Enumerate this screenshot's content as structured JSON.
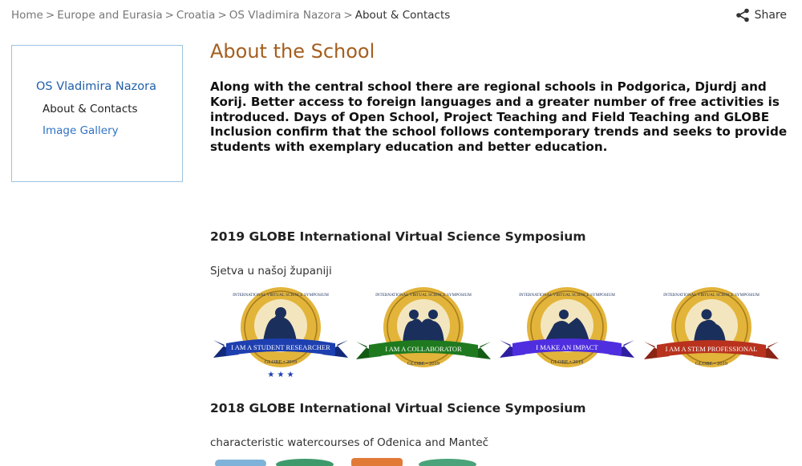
{
  "breadcrumb": {
    "items": [
      "Home",
      "Europe and Eurasia",
      "Croatia",
      "OS Vladimira Nazora"
    ],
    "separator": ">",
    "current": "About & Contacts"
  },
  "share": {
    "label": "Share",
    "icon": "share-icon"
  },
  "sidebar": {
    "school_name": "OS Vladimira Nazora",
    "items": [
      {
        "label": "About & Contacts",
        "active": true
      },
      {
        "label": "Image Gallery",
        "active": false
      }
    ]
  },
  "main": {
    "title": "About the School",
    "intro": "Along with the central school there are regional schools in Podgorica, Djurdj and Korij. Better access to foreign languages and a greater number of free activities is introduced. Days of Open School, Project Teaching and Field Teaching and GLOBE Inclusion confirm that the school follows contemporary trends and seeks to provide students with exemplary education and better education.",
    "sections": [
      {
        "heading": "2019 GLOBE International Virtual Science Symposium",
        "subtitle": "Sjetva u našoj županiji",
        "badges": [
          {
            "text": "I AM A STUDENT RESEARCHER",
            "ring_text": "INTERNATIONAL VIRTUAL SCIENCE SYMPOSIUM",
            "year": "GLOBE • 2019",
            "ribbon_color": "#1d3fb0",
            "stars": "★ ★ ★"
          },
          {
            "text": "I AM A COLLABORATOR",
            "ring_text": "INTERNATIONAL VIRTUAL SCIENCE SYMPOSIUM",
            "year": "GLOBE • 2019",
            "ribbon_color": "#1f7a1f"
          },
          {
            "text": "I MAKE AN IMPACT",
            "ring_text": "INTERNATIONAL VIRTUAL SCIENCE SYMPOSIUM",
            "year": "GLOBE • 2019",
            "ribbon_color": "#4f2ee0"
          },
          {
            "text": "I AM A STEM PROFESSIONAL",
            "ring_text": "INTERNATIONAL VIRTUAL SCIENCE SYMPOSIUM",
            "year": "GLOBE • 2019",
            "ribbon_color": "#b8321e"
          }
        ]
      },
      {
        "heading": "2018 GLOBE International Virtual Science Symposium",
        "subtitle": "characteristic watercourses of Ođenica and Manteč"
      }
    ]
  },
  "colors": {
    "title": "#a55e1f",
    "link": "#2f72c4",
    "sidebar_border": "#9cc3e0",
    "badge_gold": "#e2b43a",
    "badge_navy": "#1b2f5c"
  }
}
